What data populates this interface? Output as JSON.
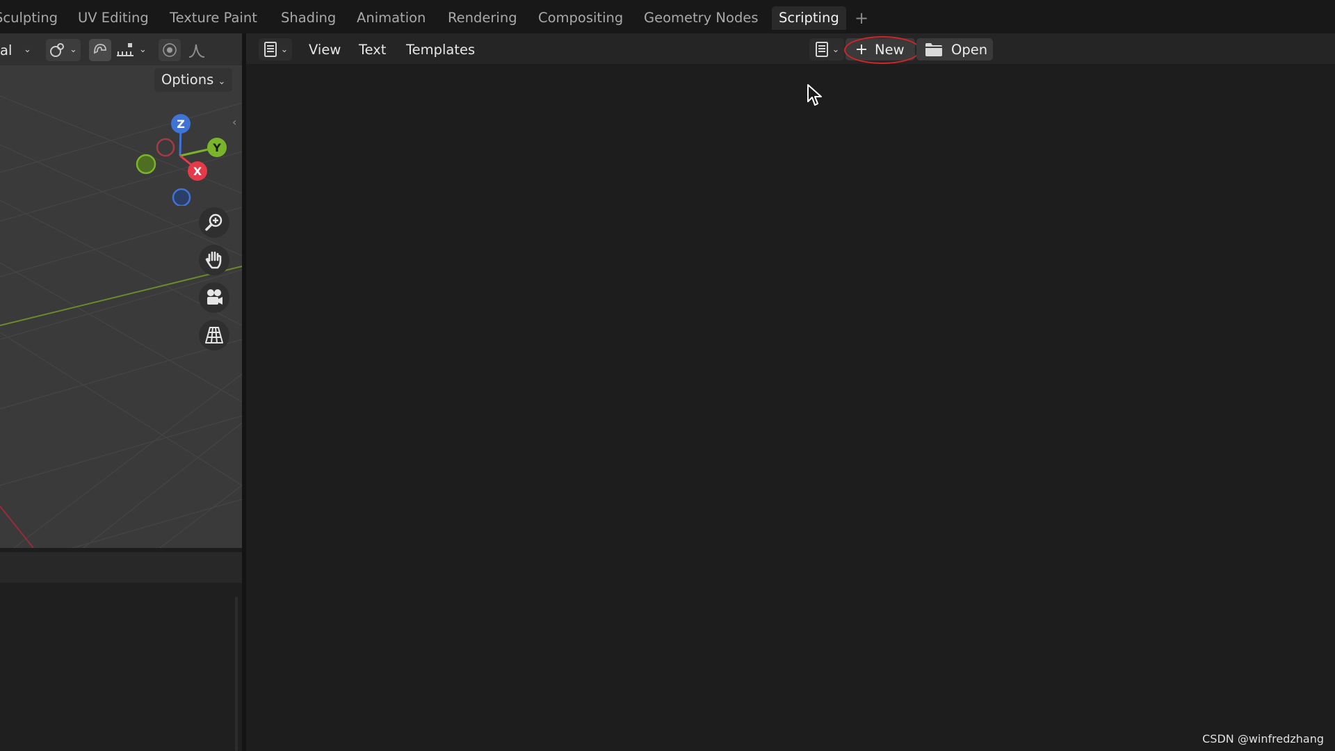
{
  "workspace_tabs": [
    {
      "label": "Sculpting",
      "active": false
    },
    {
      "label": "UV Editing",
      "active": false
    },
    {
      "label": "Texture Paint",
      "active": false
    },
    {
      "label": "Shading",
      "active": false
    },
    {
      "label": "Animation",
      "active": false
    },
    {
      "label": "Rendering",
      "active": false
    },
    {
      "label": "Compositing",
      "active": false
    },
    {
      "label": "Geometry Nodes",
      "active": false
    },
    {
      "label": "Scripting",
      "active": true
    }
  ],
  "add_workspace_label": "+",
  "viewport": {
    "mode_label": "al",
    "options_label": "Options",
    "gizmo": {
      "x_label": "X",
      "y_label": "Y",
      "z_label": "Z"
    },
    "nav_buttons": [
      "zoom-icon",
      "hand-pan-icon",
      "camera-icon",
      "grid-perspective-icon"
    ]
  },
  "text_editor": {
    "menu": {
      "view": "View",
      "text": "Text",
      "templates": "Templates"
    },
    "new_label": "New",
    "open_label": "Open"
  },
  "colors": {
    "axis_x": "#e53a4a",
    "axis_y": "#7ab42a",
    "axis_z": "#3f74d6",
    "highlight": "#d4232a"
  },
  "watermark": "CSDN @winfredzhang"
}
